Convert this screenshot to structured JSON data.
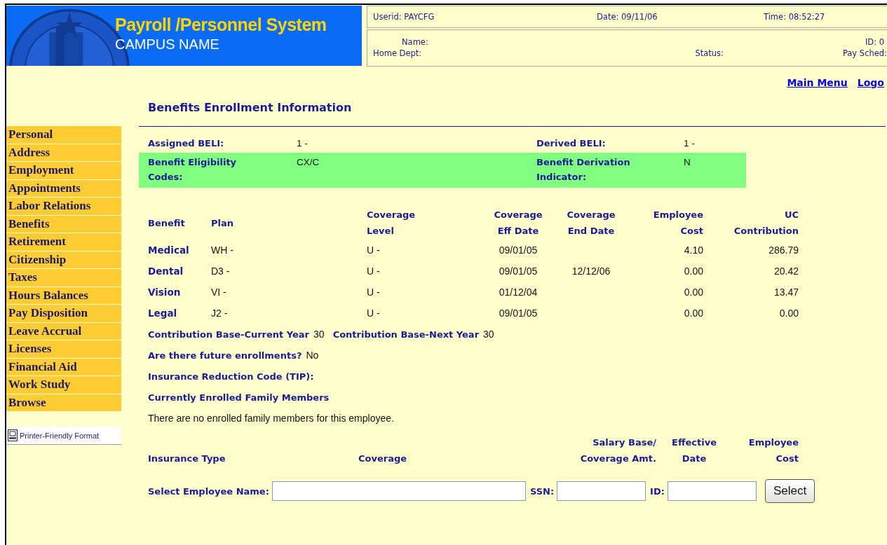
{
  "header": {
    "title": "Payroll /Personnel System",
    "subtitle": "CAMPUS NAME"
  },
  "info": {
    "userid": "Userid: PAYCFG",
    "date": "Date: 09/11/06",
    "time": "Time: 08:52:27",
    "name": "Name:",
    "id": "ID: 0",
    "home_dept": "Home Dept:",
    "status": "Status:",
    "pay_sched": "Pay Sched:"
  },
  "top_links": [
    "Main Menu",
    "Logo"
  ],
  "nav": [
    "Personal",
    "Address",
    "Employment",
    "Appointments",
    "Labor Relations",
    "Benefits",
    "Retirement",
    "Citizenship",
    "Taxes",
    "Hours Balances",
    "Pay Disposition",
    "Leave Accrual",
    "Licenses",
    "Financial Aid",
    "Work Study",
    "Browse"
  ],
  "printer_link": "Printer-Friendly Format",
  "page_title": "Benefits Enrollment Information",
  "beli_rows": [
    {
      "highlighted": false,
      "fields": [
        {
          "label": "Assigned BELI:",
          "value": "1 -"
        },
        {
          "label": "Derived BELI:",
          "value": "1 -"
        }
      ]
    },
    {
      "highlighted": true,
      "fields": [
        {
          "label": "Benefit Eligibility Codes:",
          "value": "CX/C"
        },
        {
          "label": "Benefit Derivation Indicator:",
          "value": "N"
        }
      ]
    }
  ],
  "benefits_table": {
    "columns": [
      {
        "lines": [
          "Benefit"
        ]
      },
      {
        "lines": [
          "Plan"
        ]
      },
      {
        "lines": [
          "Coverage",
          "Level"
        ]
      },
      {
        "lines": [
          "Coverage",
          "Eff Date"
        ]
      },
      {
        "lines": [
          "Coverage",
          "End Date"
        ]
      },
      {
        "lines": [
          "Employee",
          "Cost"
        ]
      },
      {
        "lines": [
          "UC",
          "Contribution"
        ]
      }
    ],
    "rows": [
      [
        "Medical",
        "WH -",
        "U -",
        "09/01/05",
        "",
        "4.10",
        "286.79"
      ],
      [
        "Dental",
        "D3 -",
        "U -",
        "09/01/05",
        "12/12/06",
        "0.00",
        "20.42"
      ],
      [
        "Vision",
        "VI -",
        "U -",
        "01/12/04",
        "",
        "0.00",
        "13.47"
      ],
      [
        "Legal",
        "J2 -",
        "U -",
        "09/01/05",
        "",
        "0.00",
        "0.00"
      ]
    ]
  },
  "contribution": [
    {
      "label": "Contribution Base-Current Year",
      "value": "30"
    },
    {
      "label": "Contribution Base-Next Year",
      "value": "30"
    }
  ],
  "future": {
    "label": "Are there future enrollments?",
    "value": "No"
  },
  "tip_label": "Insurance Reduction Code (TIP):",
  "family_heading": "Currently Enrolled Family Members",
  "family_message": "There are no enrolled family members for this employee.",
  "insurance_columns": [
    {
      "lines": [
        "Insurance Type"
      ]
    },
    {
      "lines": [
        "Coverage"
      ]
    },
    {
      "lines": [
        "Salary Base/",
        "Coverage Amt."
      ]
    },
    {
      "lines": [
        "Effective",
        "Date"
      ]
    },
    {
      "lines": [
        "Employee",
        "Cost"
      ]
    }
  ],
  "select_form": {
    "name_label": "Select Employee Name:",
    "ssn_label": "SSN:",
    "id_label": "ID:",
    "button": "Select"
  }
}
